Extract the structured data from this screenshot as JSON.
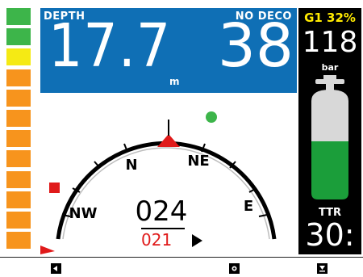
{
  "depth": {
    "label": "DEPTH",
    "value": "17.7",
    "unit": "m"
  },
  "no_deco": {
    "label": "NO DECO",
    "value": "38"
  },
  "gas": {
    "name": "G1 32%",
    "pressure": "118",
    "pressure_unit": "bar",
    "level": 0.5
  },
  "ttr": {
    "label": "TTR",
    "value": "30:"
  },
  "compass": {
    "cardinals": [
      "N",
      "NE",
      "E",
      "NW"
    ],
    "heading": "024",
    "bearing": "021"
  },
  "ascent_rate": {
    "segments": [
      "green",
      "green",
      "yellow",
      "orange",
      "orange",
      "orange",
      "orange",
      "orange",
      "orange",
      "orange",
      "orange",
      "orange"
    ]
  },
  "colors": {
    "blue_panel": "#0f6fb5",
    "green": "#3db54a",
    "yellow": "#f5ea14",
    "orange": "#f7941d",
    "red": "#e01a1a",
    "tank_green": "#1b9e3a",
    "tank_grey": "#d8d8d8"
  },
  "softkeys": [
    "left-key-icon",
    "center-key-icon",
    "right-key-icon"
  ]
}
